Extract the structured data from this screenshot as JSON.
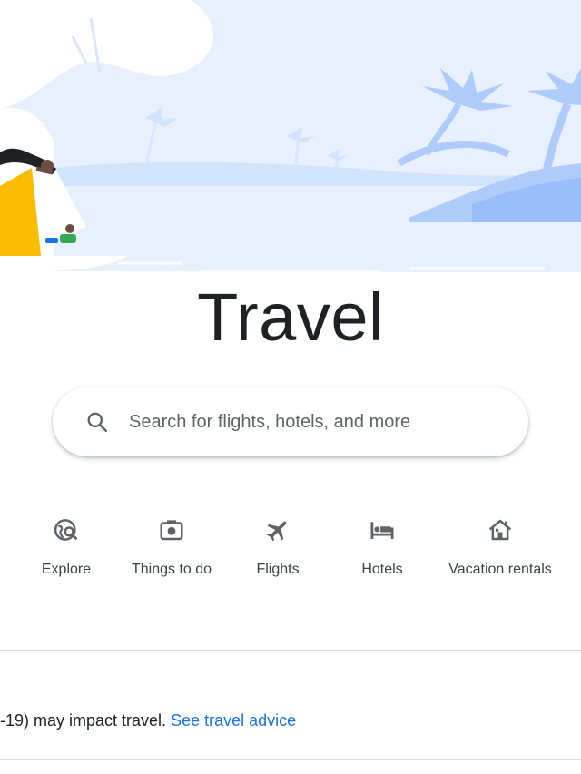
{
  "page": {
    "title": "Travel"
  },
  "search": {
    "placeholder": "Search for flights, hotels, and more"
  },
  "categories": [
    {
      "label": "Explore",
      "icon": "explore-icon"
    },
    {
      "label": "Things to do",
      "icon": "camera-icon"
    },
    {
      "label": "Flights",
      "icon": "airplane-icon"
    },
    {
      "label": "Hotels",
      "icon": "bed-icon"
    },
    {
      "label": "Vacation rentals",
      "icon": "house-icon"
    }
  ],
  "advisory": {
    "text": "-19) may impact travel. ",
    "link_text": "See travel advice"
  },
  "colors": {
    "link": "#1a73e8",
    "text": "#202124",
    "icon": "#5f6368",
    "hero_light": "#e8f0fe",
    "hero_mid": "#aecbfa",
    "hero_dark": "#8ab4f8",
    "accent_yellow": "#fbbc04"
  }
}
